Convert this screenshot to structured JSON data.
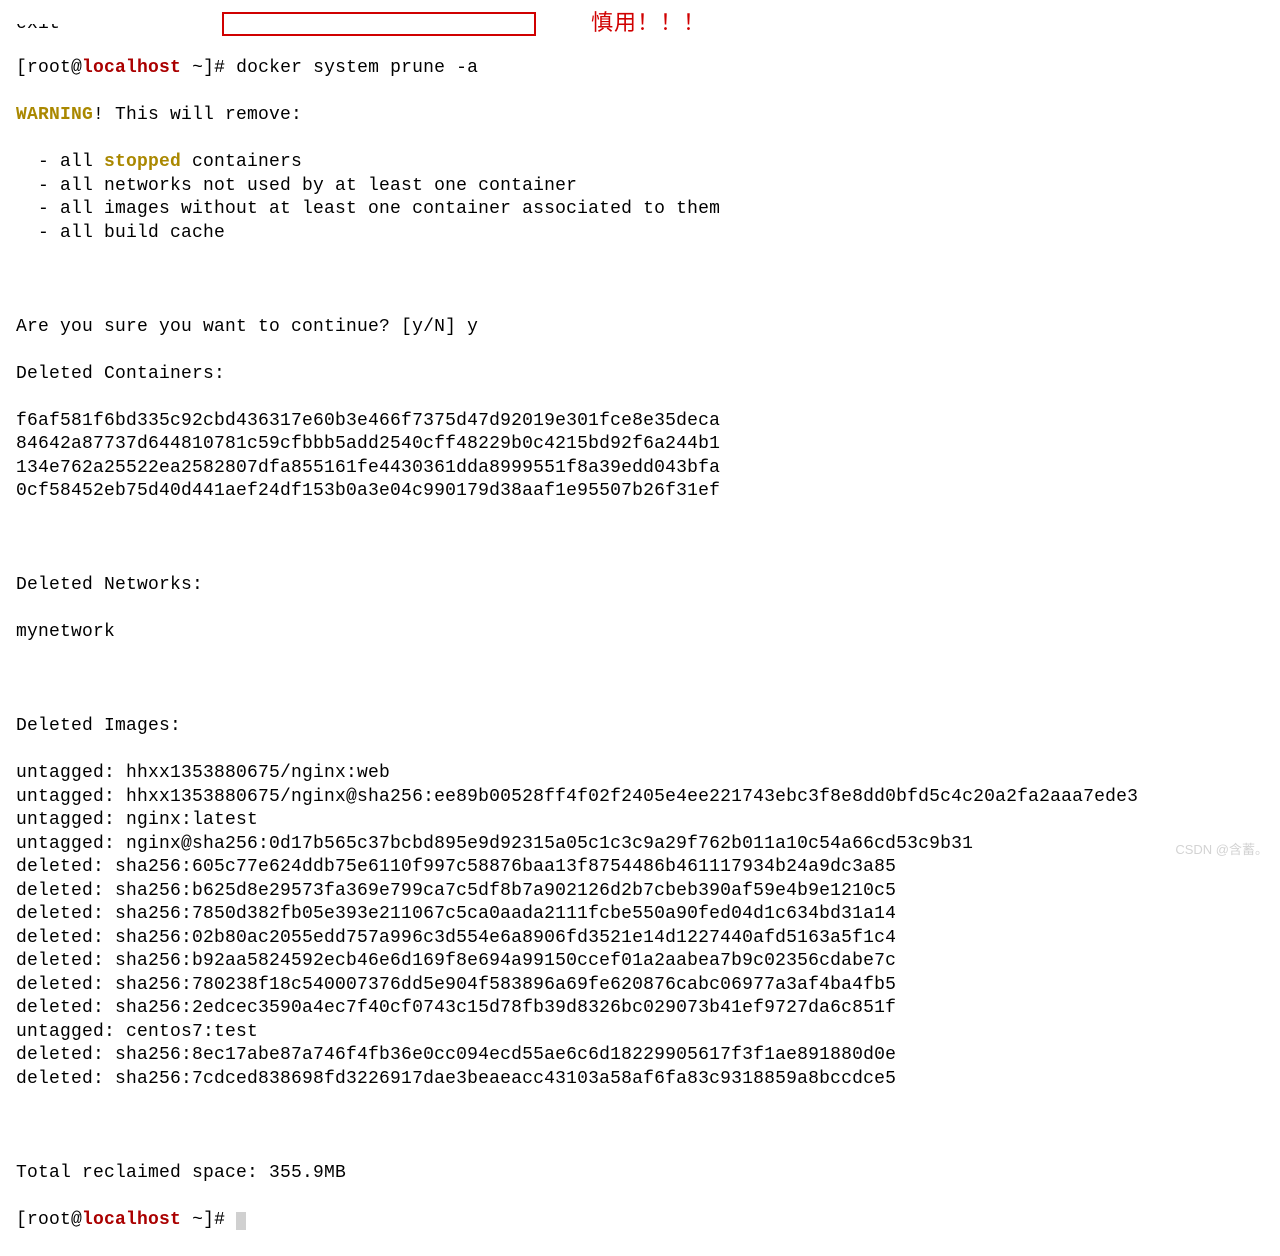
{
  "partial_top": "exit",
  "prompt": {
    "bracket_open": "[",
    "user": "root",
    "at": "@",
    "host": "localhost",
    "sep": " ~",
    "bracket_close": "]",
    "hash": "# "
  },
  "command": "docker system prune -a",
  "annotation": "慎用！！！",
  "warning_label": "WARNING",
  "warning_rest": "! This will remove:",
  "remove_list_prefix": "  - ",
  "remove_items": [
    {
      "pre": "all ",
      "hl": "stopped",
      "post": " containers"
    },
    {
      "pre": "all networks not used by at least one container",
      "hl": "",
      "post": ""
    },
    {
      "pre": "all images without at least one container associated to them",
      "hl": "",
      "post": ""
    },
    {
      "pre": "all build cache",
      "hl": "",
      "post": ""
    }
  ],
  "confirm_prompt": "Are you sure you want to continue? [y/N] y",
  "deleted_containers_label": "Deleted Containers:",
  "deleted_containers": [
    "f6af581f6bd335c92cbd436317e60b3e466f7375d47d92019e301fce8e35deca",
    "84642a87737d644810781c59cfbbb5add2540cff48229b0c4215bd92f6a244b1",
    "134e762a25522ea2582807dfa855161fe4430361dda8999551f8a39edd043bfa",
    "0cf58452eb75d40d441aef24df153b0a3e04c990179d38aaf1e95507b26f31ef"
  ],
  "deleted_networks_label": "Deleted Networks:",
  "deleted_networks": [
    "mynetwork"
  ],
  "deleted_images_label": "Deleted Images:",
  "deleted_images": [
    "untagged: hhxx1353880675/nginx:web",
    "untagged: hhxx1353880675/nginx@sha256:ee89b00528ff4f02f2405e4ee221743ebc3f8e8dd0bfd5c4c20a2fa2aaa7ede3",
    "untagged: nginx:latest",
    "untagged: nginx@sha256:0d17b565c37bcbd895e9d92315a05c1c3c9a29f762b011a10c54a66cd53c9b31",
    "deleted: sha256:605c77e624ddb75e6110f997c58876baa13f8754486b461117934b24a9dc3a85",
    "deleted: sha256:b625d8e29573fa369e799ca7c5df8b7a902126d2b7cbeb390af59e4b9e1210c5",
    "deleted: sha256:7850d382fb05e393e211067c5ca0aada2111fcbe550a90fed04d1c634bd31a14",
    "deleted: sha256:02b80ac2055edd757a996c3d554e6a8906fd3521e14d1227440afd5163a5f1c4",
    "deleted: sha256:b92aa5824592ecb46e6d169f8e694a99150ccef01a2aabea7b9c02356cdabe7c",
    "deleted: sha256:780238f18c540007376dd5e904f583896a69fe620876cabc06977a3af4ba4fb5",
    "deleted: sha256:2edcec3590a4ec7f40cf0743c15d78fb39d8326bc029073b41ef9727da6c851f",
    "untagged: centos7:test",
    "deleted: sha256:8ec17abe87a746f4fb36e0cc094ecd55ae6c6d18229905617f3f1ae891880d0e",
    "deleted: sha256:7cdced838698fd3226917dae3beaeacc43103a58af6fa83c9318859a8bccdce5"
  ],
  "reclaimed": "Total reclaimed space: 355.9MB",
  "watermark": "CSDN @含蓄。"
}
